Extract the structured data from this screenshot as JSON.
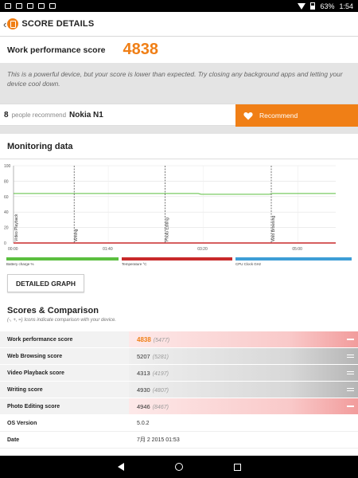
{
  "status_bar": {
    "battery": "63%",
    "time": "1:54"
  },
  "app_bar": {
    "title": "SCORE DETAILS",
    "back_icon": "chevron-left-icon"
  },
  "score": {
    "label": "Work performance score",
    "value": "4838"
  },
  "description": "This is a powerful device, but your score is lower than expected. Try closing any background apps and letting your device cool down.",
  "recommend": {
    "count": "8",
    "people_text": "people recommend",
    "device": "Nokia N1",
    "button_label": "Recommend"
  },
  "monitoring": {
    "title": "Monitoring data",
    "detailed_graph_button": "DETAILED GRAPH",
    "legend": [
      {
        "label": "Battery charge %",
        "color": "#5bbf3f"
      },
      {
        "label": "Temperature °C",
        "color": "#c8292a"
      },
      {
        "label": "CPU Clock GHz",
        "color": "#3d9ed6"
      }
    ]
  },
  "chart_data": {
    "type": "line",
    "xlabel": "",
    "ylabel": "",
    "ylim": [
      0,
      100
    ],
    "yticks": [
      "0",
      "20",
      "40",
      "60",
      "80",
      "100"
    ],
    "x_tick_labels": [
      "00:00",
      "01:40",
      "03:20",
      "05:00"
    ],
    "x_tick_values": [
      0,
      100,
      200,
      300
    ],
    "xlim": [
      0,
      340
    ],
    "segments": [
      "Video Playback",
      "Writing",
      "Photo Editing",
      "Web Browsing"
    ],
    "segment_starts": [
      0,
      64,
      160,
      272
    ],
    "series": [
      {
        "name": "Battery charge %",
        "color": "#5bbf3f",
        "x": [
          0,
          195,
          198,
          270,
          273,
          340
        ],
        "values": [
          64,
          64,
          63,
          63,
          64,
          64
        ]
      },
      {
        "name": "Temperature °C",
        "color": "#c8292a",
        "x": [
          0,
          340
        ],
        "values": [
          0,
          0
        ]
      }
    ]
  },
  "scores": {
    "title": "Scores & Comparison",
    "subtitle": "(-, +, =) Icons indicate comparison with your device.",
    "rows": [
      {
        "label": "Work performance score",
        "value": "4838",
        "compare": "5477",
        "status": "lower",
        "highlight": true
      },
      {
        "label": "Web Browsing score",
        "value": "5207",
        "compare": "5281",
        "status": "equal",
        "highlight": false
      },
      {
        "label": "Video Playback score",
        "value": "4313",
        "compare": "4197",
        "status": "equal",
        "highlight": false
      },
      {
        "label": "Writing score",
        "value": "4930",
        "compare": "4807",
        "status": "equal",
        "highlight": false
      },
      {
        "label": "Photo Editing score",
        "value": "4946",
        "compare": "8467",
        "status": "lower",
        "highlight": true
      }
    ],
    "info": [
      {
        "label": "OS Version",
        "value": "5.0.2"
      },
      {
        "label": "Date",
        "value": "7月 2 2015 01:53"
      }
    ]
  }
}
